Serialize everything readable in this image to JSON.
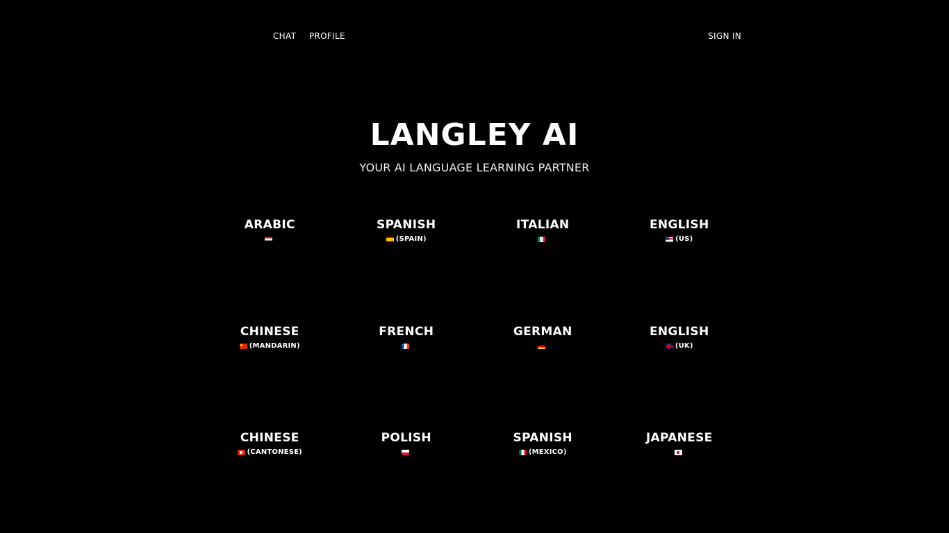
{
  "nav": {
    "chat_label": "CHAT",
    "profile_label": "PROFILE",
    "signin_label": "SIGN IN"
  },
  "hero": {
    "title": "LANGLEY AI",
    "subtitle": "YOUR AI LANGUAGE LEARNING PARTNER"
  },
  "languages": [
    {
      "name": "ARABIC",
      "variant": "",
      "flag": "egypt-flag-icon"
    },
    {
      "name": "SPANISH",
      "variant": "(SPAIN)",
      "flag": "spain-flag-icon"
    },
    {
      "name": "ITALIAN",
      "variant": "",
      "flag": "italy-flag-icon"
    },
    {
      "name": "ENGLISH",
      "variant": "(US)",
      "flag": "us-flag-icon"
    },
    {
      "name": "CHINESE",
      "variant": "(MANDARIN)",
      "flag": "china-flag-icon"
    },
    {
      "name": "FRENCH",
      "variant": "",
      "flag": "france-flag-icon"
    },
    {
      "name": "GERMAN",
      "variant": "",
      "flag": "germany-flag-icon"
    },
    {
      "name": "ENGLISH",
      "variant": "(UK)",
      "flag": "uk-flag-icon"
    },
    {
      "name": "CHINESE",
      "variant": "(CANTONESE)",
      "flag": "hong-kong-flag-icon"
    },
    {
      "name": "POLISH",
      "variant": "",
      "flag": "poland-flag-icon"
    },
    {
      "name": "SPANISH",
      "variant": "(MEXICO)",
      "flag": "mexico-flag-icon"
    },
    {
      "name": "JAPANESE",
      "variant": "",
      "flag": "japan-flag-icon"
    }
  ],
  "colors": {
    "background": "#000000",
    "text": "#ffffff"
  }
}
